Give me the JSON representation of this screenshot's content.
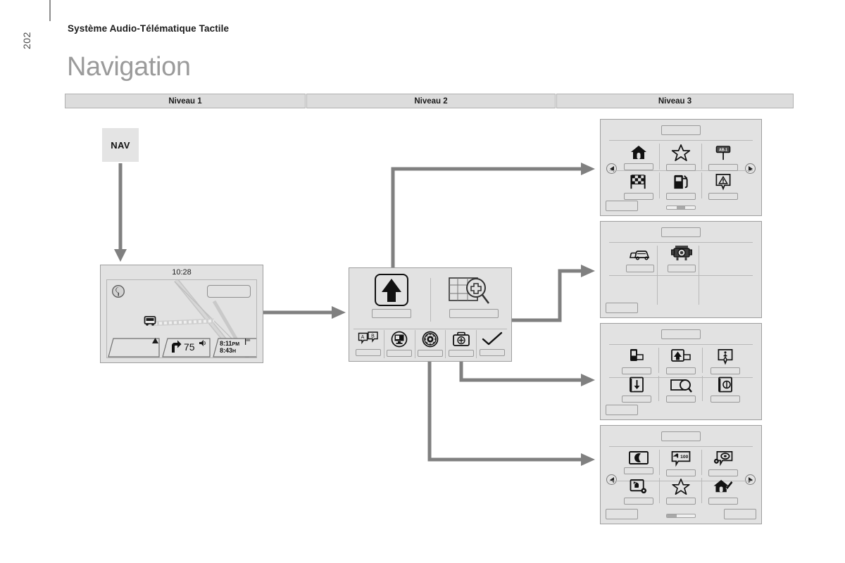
{
  "page": {
    "number": "202",
    "subtitle": "Système Audio-Télématique Tactile",
    "title": "Navigation"
  },
  "levels": [
    {
      "label": "Niveau 1"
    },
    {
      "label": "Niveau 2"
    },
    {
      "label": "Niveau 3"
    }
  ],
  "hardkey": {
    "label": "NAV"
  },
  "colors": {
    "header_fill": "#dcdcdc",
    "header_border": "#b0b0b0",
    "screen_fill": "#e2e2e2",
    "screen_border": "#9e9e9e",
    "connector": "#808080",
    "title_gray": "#9b9b9b",
    "navkey_fill": "#e4e4e4"
  },
  "level1": {
    "name": "navigation-map-screen",
    "clock": "10:28",
    "compass_icon": "compass-icon",
    "destination_field": "",
    "vehicle_icon": "vehicle-marker-icon",
    "status_bar": {
      "left_segment_icon": "chevron-up-icon",
      "turn_icon": "turn-right-icon",
      "distance": "75",
      "volume_icon": "speaker-icon",
      "arrival_time": "8:11",
      "arrival_meridiem": "PM",
      "duration": "8:43",
      "duration_unit": "H",
      "flag_icon": "flag-icon"
    }
  },
  "level2": {
    "name": "navigation-menu-screen",
    "top_buttons": [
      {
        "icon": "guidance-arrow-icon",
        "label": ""
      },
      {
        "icon": "map-search-icon",
        "label": ""
      }
    ],
    "toolbar_buttons": [
      {
        "icon": "language-ab-icon",
        "label": ""
      },
      {
        "icon": "display-settings-icon",
        "label": ""
      },
      {
        "icon": "gear-wheel-icon",
        "label": ""
      },
      {
        "icon": "first-aid-kit-icon",
        "label": ""
      },
      {
        "icon": "check-mark-icon",
        "label": ""
      }
    ]
  },
  "level3": [
    {
      "name": "destination-entry-panel",
      "title": "",
      "prev_arrow": "arrow-left-icon",
      "next_arrow": "arrow-right-icon",
      "footer_left": "",
      "scrollbar": {
        "visible": true,
        "thumb_percent": 30,
        "thumb_align": "center"
      },
      "items": [
        {
          "icon": "home-icon",
          "label": ""
        },
        {
          "icon": "star-favourite-icon",
          "label": ""
        },
        {
          "icon": "address-sign-icon",
          "label": ""
        },
        {
          "icon": "checkered-flag-icon",
          "label": ""
        },
        {
          "icon": "fuel-pump-icon",
          "label": ""
        },
        {
          "icon": "warning-poi-icon",
          "label": ""
        }
      ]
    },
    {
      "name": "traffic-camera-panel",
      "title": "",
      "footer_left": "",
      "items": [
        {
          "icon": "cars-traffic-icon",
          "label": ""
        },
        {
          "icon": "speed-camera-icon",
          "label": ""
        }
      ]
    },
    {
      "name": "route-options-panel",
      "title": "",
      "footer_left": "",
      "items": [
        {
          "icon": "usb-device-icon",
          "label": ""
        },
        {
          "icon": "upload-arrow-icon",
          "label": ""
        },
        {
          "icon": "pedestrian-poi-icon",
          "label": ""
        },
        {
          "icon": "download-book-icon",
          "label": ""
        },
        {
          "icon": "map-zoom-icon",
          "label": ""
        },
        {
          "icon": "info-book-icon",
          "label": ""
        }
      ]
    },
    {
      "name": "navigation-settings-panel",
      "title": "",
      "prev_arrow": "arrow-left-icon",
      "next_arrow": "arrow-right-icon",
      "footer_left": "",
      "footer_right": "",
      "scrollbar": {
        "visible": true,
        "thumb_percent": 35,
        "thumb_align": "left"
      },
      "items": [
        {
          "icon": "night-mode-icon",
          "label": ""
        },
        {
          "icon": "speed-limit-bubble-icon",
          "label": ""
        },
        {
          "icon": "poi-settings-icon",
          "label": ""
        },
        {
          "icon": "reset-settings-icon",
          "label": ""
        },
        {
          "icon": "star-favourite-icon",
          "label": ""
        },
        {
          "icon": "home-edit-icon",
          "label": ""
        }
      ]
    }
  ],
  "connectors": [
    {
      "name": "nav-to-map-connector",
      "from": "NAV",
      "to": "navigation-map-screen",
      "direction": "down"
    },
    {
      "name": "map-to-menu-connector",
      "from": "navigation-map-screen",
      "to": "navigation-menu-screen",
      "direction": "right"
    },
    {
      "name": "guidance-to-destination-connector",
      "from": "guidance-arrow-icon",
      "to": "destination-entry-panel",
      "direction": "up-right"
    },
    {
      "name": "display-to-traffic-connector",
      "from": "display-settings-icon",
      "to": "traffic-camera-panel",
      "direction": "right"
    },
    {
      "name": "firstaid-to-route-connector",
      "from": "first-aid-kit-icon",
      "to": "route-options-panel",
      "direction": "down-right"
    },
    {
      "name": "gear-to-settings-connector",
      "from": "gear-wheel-icon",
      "to": "navigation-settings-panel",
      "direction": "down-right"
    }
  ]
}
